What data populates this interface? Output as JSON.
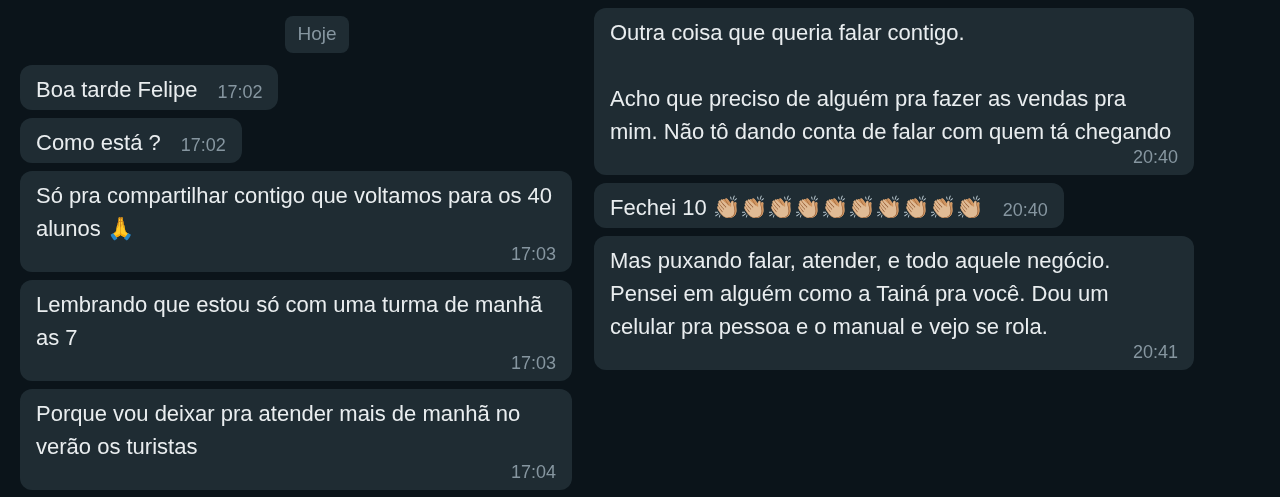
{
  "date_chip": "Hoje",
  "left_messages": [
    {
      "kind": "short",
      "text": "Boa tarde Felipe",
      "time": "17:02"
    },
    {
      "kind": "short",
      "text": "Como está ?",
      "time": "17:02"
    },
    {
      "kind": "long",
      "text": "Só pra compartilhar contigo que voltamos para os 40 alunos 🙏",
      "time": "17:03"
    },
    {
      "kind": "long",
      "text": "Lembrando que estou só com uma turma de manhã as 7",
      "time": "17:03"
    },
    {
      "kind": "long",
      "text": "Porque vou deixar pra atender mais de manhã no verão os turistas",
      "time": "17:04"
    }
  ],
  "right_messages": [
    {
      "kind": "long",
      "text": "Outra coisa que queria falar contigo.\n\nAcho que preciso de alguém pra fazer as vendas pra mim. Não tô dando conta de falar com quem tá chegando",
      "time": "20:40"
    },
    {
      "kind": "short",
      "text": "Fechei 10 👏🏼👏🏼👏🏼👏🏼👏🏼👏🏼👏🏼👏🏼👏🏼👏🏼",
      "time": "20:40"
    },
    {
      "kind": "long",
      "text": "Mas puxando falar, atender, e todo aquele negócio.  Pensei em alguém como a Tainá pra você. Dou um celular pra pessoa e o manual e vejo se rola.",
      "time": "20:41"
    }
  ]
}
